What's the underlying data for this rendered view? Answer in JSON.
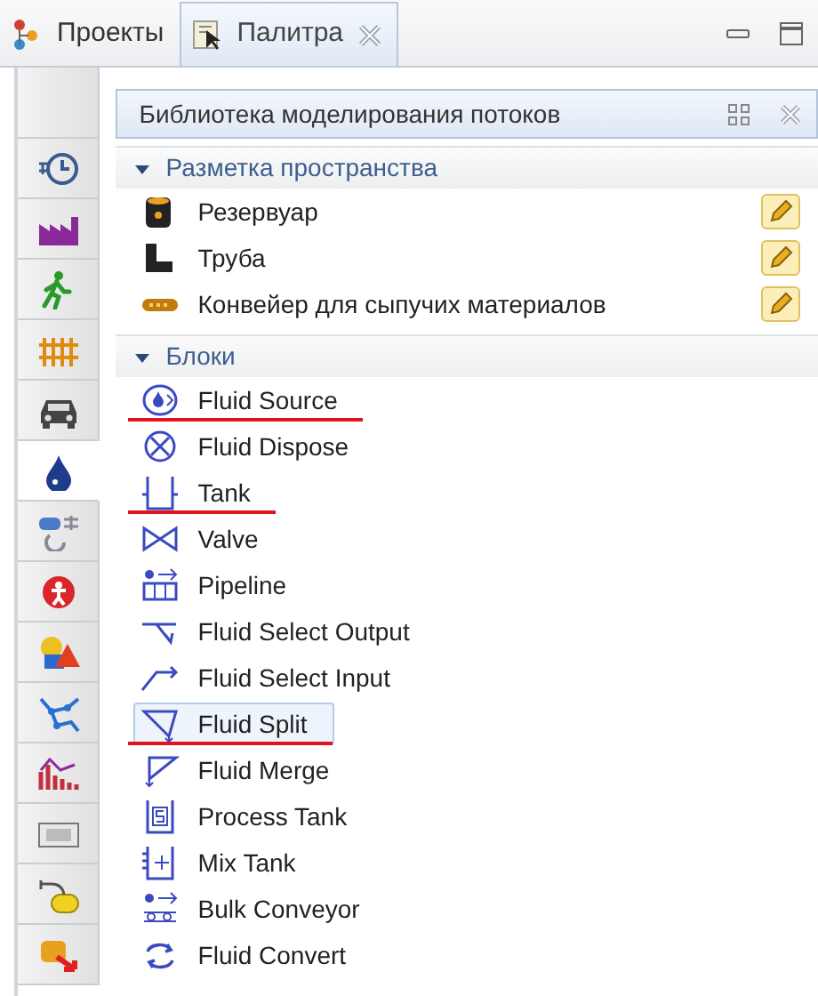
{
  "tabs": [
    {
      "label": "Проекты",
      "selected": false,
      "kind": "projects",
      "closable": false
    },
    {
      "label": "Палитра",
      "selected": true,
      "kind": "palette",
      "closable": true
    }
  ],
  "sidebar": {
    "items": [
      {
        "kind": "blank",
        "selected": false
      },
      {
        "kind": "clock",
        "selected": false
      },
      {
        "kind": "factory",
        "selected": false
      },
      {
        "kind": "walker",
        "selected": false
      },
      {
        "kind": "rail",
        "selected": false
      },
      {
        "kind": "car",
        "selected": false
      },
      {
        "kind": "drop",
        "selected": true
      },
      {
        "kind": "pipes",
        "selected": false
      },
      {
        "kind": "alert",
        "selected": false
      },
      {
        "kind": "shapes",
        "selected": false
      },
      {
        "kind": "network",
        "selected": false
      },
      {
        "kind": "chart",
        "selected": false
      },
      {
        "kind": "okbutton",
        "selected": false
      },
      {
        "kind": "state",
        "selected": false
      },
      {
        "kind": "transfer",
        "selected": false
      }
    ]
  },
  "palette": {
    "title": "Библиотека моделирования потоков",
    "sections": [
      {
        "title": "Разметка пространства",
        "expanded": true,
        "items": [
          {
            "label": "Резервуар",
            "kind": "barrel",
            "editable": true,
            "selected": false,
            "underlined": false
          },
          {
            "label": "Труба",
            "kind": "elbow",
            "editable": true,
            "selected": false,
            "underlined": false
          },
          {
            "label": "Конвейер для сыпучих материалов",
            "kind": "belt",
            "editable": true,
            "selected": false,
            "underlined": false
          }
        ]
      },
      {
        "title": "Блоки",
        "expanded": true,
        "items": [
          {
            "label": "Fluid Source",
            "kind": "source",
            "editable": false,
            "selected": false,
            "underlined": true
          },
          {
            "label": "Fluid Dispose",
            "kind": "dispose",
            "editable": false,
            "selected": false,
            "underlined": false
          },
          {
            "label": "Tank",
            "kind": "tank",
            "editable": false,
            "selected": false,
            "underlined": true
          },
          {
            "label": "Valve",
            "kind": "valve",
            "editable": false,
            "selected": false,
            "underlined": false
          },
          {
            "label": "Pipeline",
            "kind": "pipeline",
            "editable": false,
            "selected": false,
            "underlined": false
          },
          {
            "label": "Fluid Select Output",
            "kind": "selout",
            "editable": false,
            "selected": false,
            "underlined": false
          },
          {
            "label": "Fluid Select Input",
            "kind": "selin",
            "editable": false,
            "selected": false,
            "underlined": false
          },
          {
            "label": "Fluid Split",
            "kind": "split",
            "editable": false,
            "selected": true,
            "underlined": true
          },
          {
            "label": "Fluid Merge",
            "kind": "merge",
            "editable": false,
            "selected": false,
            "underlined": false
          },
          {
            "label": "Process Tank",
            "kind": "ptank",
            "editable": false,
            "selected": false,
            "underlined": false
          },
          {
            "label": "Mix Tank",
            "kind": "mtank",
            "editable": false,
            "selected": false,
            "underlined": false
          },
          {
            "label": "Bulk Conveyor",
            "kind": "bulk",
            "editable": false,
            "selected": false,
            "underlined": false
          },
          {
            "label": "Fluid Convert",
            "kind": "convert",
            "editable": false,
            "selected": false,
            "underlined": false
          }
        ]
      }
    ]
  }
}
